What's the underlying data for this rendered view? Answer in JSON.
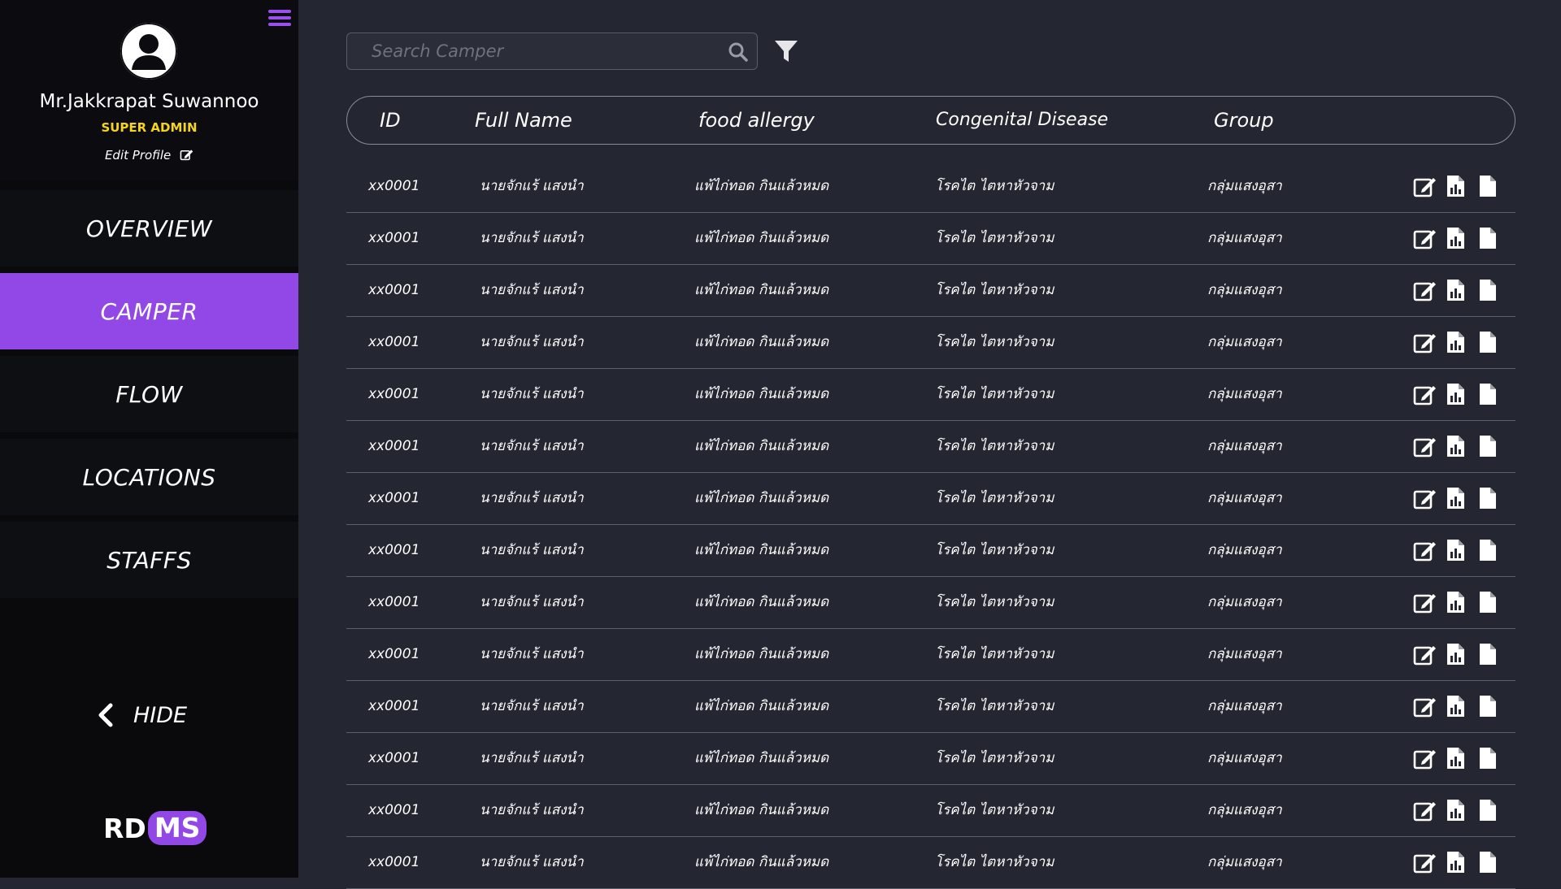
{
  "user": {
    "name": "Mr.Jakkrapat Suwannoo",
    "role": "SUPER ADMIN",
    "edit_label": "Edit Profile"
  },
  "nav": {
    "overview": "OVERVIEW",
    "camper": "CAMPER",
    "flow": "FLOW",
    "locations": "LOCATIONS",
    "staffs": "STAFFS",
    "hide": "HIDE"
  },
  "logo": {
    "rd": "RD",
    "ms": "MS"
  },
  "search": {
    "placeholder": "Search Camper"
  },
  "table": {
    "headers": {
      "id": "ID",
      "full_name": "Full Name",
      "food_allergy": "food allergy",
      "congenital_disease": "Congenital Disease",
      "group": "Group"
    },
    "rows": [
      {
        "id": "xx0001",
        "name": "นายจักแร้ แสงนำ",
        "allergy": "แพ้ไก่ทอด กินแล้วหมด",
        "disease": "โรคไต ไตหาหัวจาม",
        "group": "กลุ่มแสงอุสา"
      },
      {
        "id": "xx0001",
        "name": "นายจักแร้ แสงนำ",
        "allergy": "แพ้ไก่ทอด กินแล้วหมด",
        "disease": "โรคไต ไตหาหัวจาม",
        "group": "กลุ่มแสงอุสา"
      },
      {
        "id": "xx0001",
        "name": "นายจักแร้ แสงนำ",
        "allergy": "แพ้ไก่ทอด กินแล้วหมด",
        "disease": "โรคไต ไตหาหัวจาม",
        "group": "กลุ่มแสงอุสา"
      },
      {
        "id": "xx0001",
        "name": "นายจักแร้ แสงนำ",
        "allergy": "แพ้ไก่ทอด กินแล้วหมด",
        "disease": "โรคไต ไตหาหัวจาม",
        "group": "กลุ่มแสงอุสา"
      },
      {
        "id": "xx0001",
        "name": "นายจักแร้ แสงนำ",
        "allergy": "แพ้ไก่ทอด กินแล้วหมด",
        "disease": "โรคไต ไตหาหัวจาม",
        "group": "กลุ่มแสงอุสา"
      },
      {
        "id": "xx0001",
        "name": "นายจักแร้ แสงนำ",
        "allergy": "แพ้ไก่ทอด กินแล้วหมด",
        "disease": "โรคไต ไตหาหัวจาม",
        "group": "กลุ่มแสงอุสา"
      },
      {
        "id": "xx0001",
        "name": "นายจักแร้ แสงนำ",
        "allergy": "แพ้ไก่ทอด กินแล้วหมด",
        "disease": "โรคไต ไตหาหัวจาม",
        "group": "กลุ่มแสงอุสา"
      },
      {
        "id": "xx0001",
        "name": "นายจักแร้ แสงนำ",
        "allergy": "แพ้ไก่ทอด กินแล้วหมด",
        "disease": "โรคไต ไตหาหัวจาม",
        "group": "กลุ่มแสงอุสา"
      },
      {
        "id": "xx0001",
        "name": "นายจักแร้ แสงนำ",
        "allergy": "แพ้ไก่ทอด กินแล้วหมด",
        "disease": "โรคไต ไตหาหัวจาม",
        "group": "กลุ่มแสงอุสา"
      },
      {
        "id": "xx0001",
        "name": "นายจักแร้ แสงนำ",
        "allergy": "แพ้ไก่ทอด กินแล้วหมด",
        "disease": "โรคไต ไตหาหัวจาม",
        "group": "กลุ่มแสงอุสา"
      },
      {
        "id": "xx0001",
        "name": "นายจักแร้ แสงนำ",
        "allergy": "แพ้ไก่ทอด กินแล้วหมด",
        "disease": "โรคไต ไตหาหัวจาม",
        "group": "กลุ่มแสงอุสา"
      },
      {
        "id": "xx0001",
        "name": "นายจักแร้ แสงนำ",
        "allergy": "แพ้ไก่ทอด กินแล้วหมด",
        "disease": "โรคไต ไตหาหัวจาม",
        "group": "กลุ่มแสงอุสา"
      },
      {
        "id": "xx0001",
        "name": "นายจักแร้ แสงนำ",
        "allergy": "แพ้ไก่ทอด กินแล้วหมด",
        "disease": "โรคไต ไตหาหัวจาม",
        "group": "กลุ่มแสงอุสา"
      },
      {
        "id": "xx0001",
        "name": "นายจักแร้ แสงนำ",
        "allergy": "แพ้ไก่ทอด กินแล้วหมด",
        "disease": "โรคไต ไตหาหัวจาม",
        "group": "กลุ่มแสงอุสา"
      }
    ]
  },
  "icons": {
    "menu": "hamburger-menu-icon",
    "avatar": "user-avatar-icon",
    "edit": "edit-icon",
    "search": "search-icon",
    "filter": "filter-icon",
    "chevron": "chevron-left-icon",
    "row_actions": [
      "edit-icon",
      "document-chart-icon",
      "file-icon"
    ]
  },
  "colors": {
    "accent": "#9148e6",
    "role": "#f5d41f",
    "background": "#242631",
    "sidebar": "#0a0a0d"
  }
}
